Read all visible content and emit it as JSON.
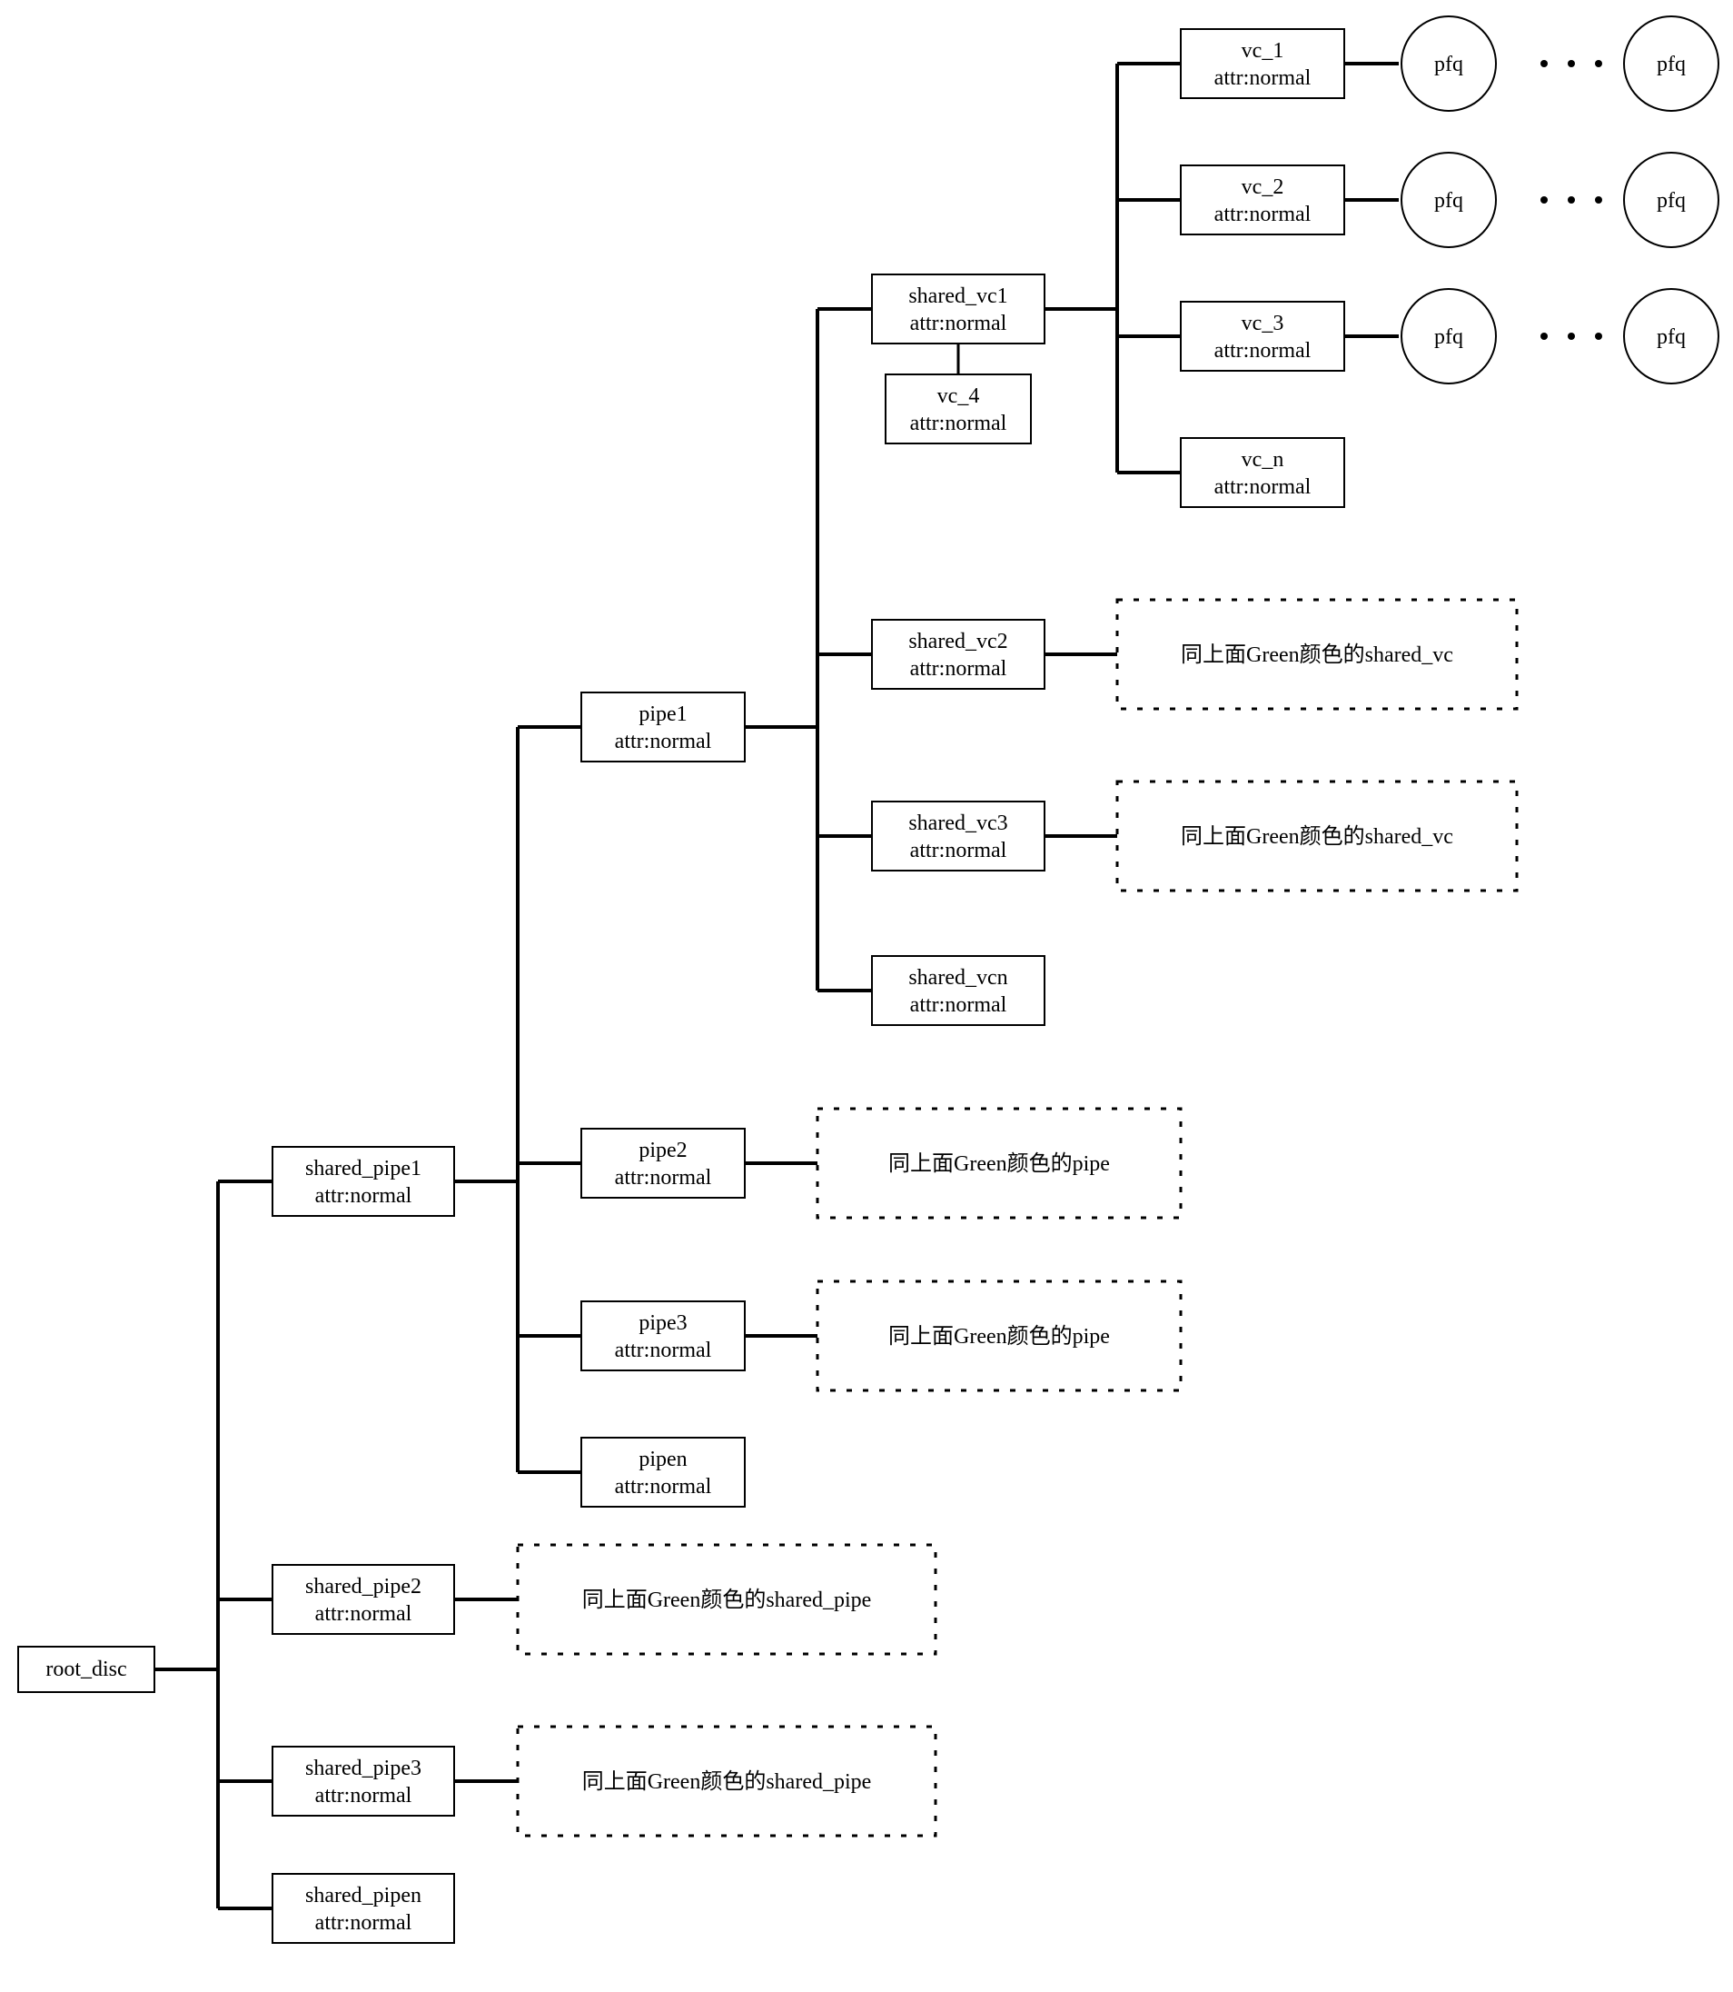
{
  "root": {
    "name": "root_disc"
  },
  "shared_pipe": [
    {
      "name": "shared_pipe1",
      "attr": "attr:normal"
    },
    {
      "name": "shared_pipe2",
      "attr": "attr:normal"
    },
    {
      "name": "shared_pipe3",
      "attr": "attr:normal"
    },
    {
      "name": "shared_pipen",
      "attr": "attr:normal"
    }
  ],
  "pipe": [
    {
      "name": "pipe1",
      "attr": "attr:normal"
    },
    {
      "name": "pipe2",
      "attr": "attr:normal"
    },
    {
      "name": "pipe3",
      "attr": "attr:normal"
    },
    {
      "name": "pipen",
      "attr": "attr:normal"
    }
  ],
  "shared_vc": [
    {
      "name": "shared_vc1",
      "attr": "attr:normal"
    },
    {
      "name": "shared_vc2",
      "attr": "attr:normal"
    },
    {
      "name": "shared_vc3",
      "attr": "attr:normal"
    },
    {
      "name": "shared_vcn",
      "attr": "attr:normal"
    }
  ],
  "vc": [
    {
      "name": "vc_1",
      "attr": "attr:normal"
    },
    {
      "name": "vc_2",
      "attr": "attr:normal"
    },
    {
      "name": "vc_3",
      "attr": "attr:normal"
    },
    {
      "name": "vc_4",
      "attr": "attr:normal"
    },
    {
      "name": "vc_n",
      "attr": "attr:normal"
    }
  ],
  "pfq_label": "pfq",
  "note_shared_vc": "同上面Green颜色的shared_vc",
  "note_pipe": "同上面Green颜色的pipe",
  "note_shared_pipe": "同上面Green颜色的shared_pipe"
}
